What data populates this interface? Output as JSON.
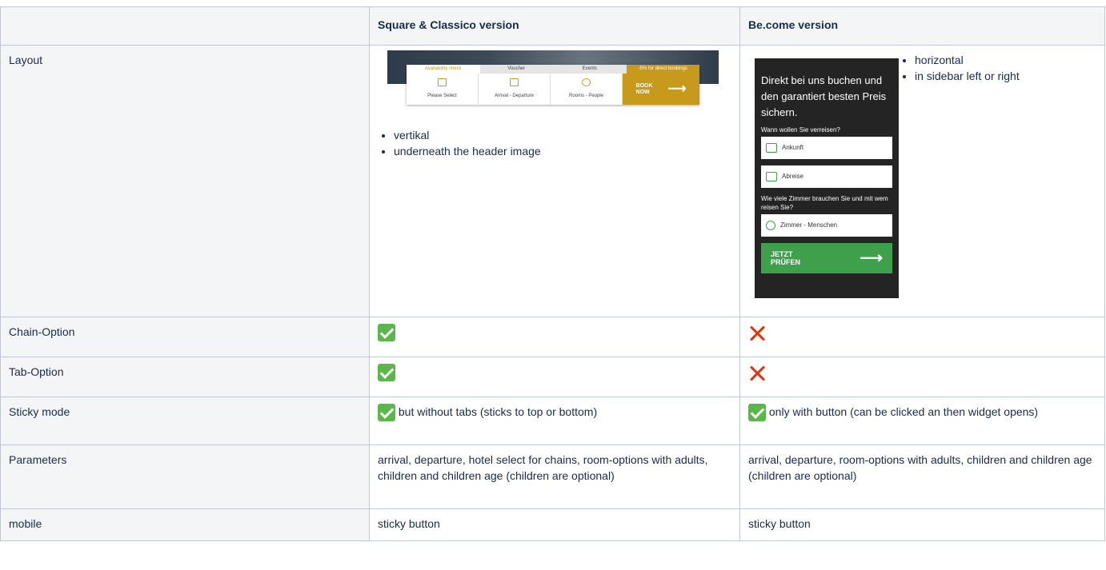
{
  "columns": [
    "",
    "Square & Classico version",
    "Be.come version"
  ],
  "rows": {
    "layout": {
      "label": "Layout",
      "square_bullets": [
        "vertikal",
        "underneath the header image"
      ],
      "become_bullets": [
        "horizontal",
        "in sidebar left or right"
      ]
    },
    "chain": {
      "label": "Chain-Option"
    },
    "tab": {
      "label": "Tab-Option"
    },
    "sticky": {
      "label": "Sticky mode",
      "square_text": "but without tabs (sticks to top or bottom)",
      "become_text": "only with button (can be clicked an then widget opens)"
    },
    "params": {
      "label": "Parameters",
      "square_text": "arrival, departure, hotel select for chains, room-options with adults, children and children age (children are optional)",
      "become_text": "arrival, departure, room-options with adults, children and children age (children are optional)"
    },
    "mobile": {
      "label": "mobile",
      "square_text": "sticky button",
      "become_text": "sticky button"
    }
  },
  "square_widget": {
    "tabs": [
      "Availability check",
      "Voucher",
      "Events",
      "-5% for direct bookings"
    ],
    "fields": [
      "Please Select",
      "Arrival - Departure",
      "Rooms - People"
    ],
    "book": "BOOK NOW",
    "arrow": "⟶",
    "accent": "#c89a1b"
  },
  "become_widget": {
    "headline": "Direkt bei uns buchen und den garantiert besten Preis sichern.",
    "q1": "Wann wollen Sie verreisen?",
    "arrival": "Ankunft",
    "departure": "Abreise",
    "q2": "Wie viele Zimmer brauchen Sie und mit wem reisen Sie?",
    "rooms": "Zimmer - Menschen",
    "cta": "JETZT PRÜFEN",
    "arrow": "⟶",
    "accent": "#3fa04b"
  },
  "icons": {
    "check": "check-icon",
    "cross": "cross-icon"
  }
}
